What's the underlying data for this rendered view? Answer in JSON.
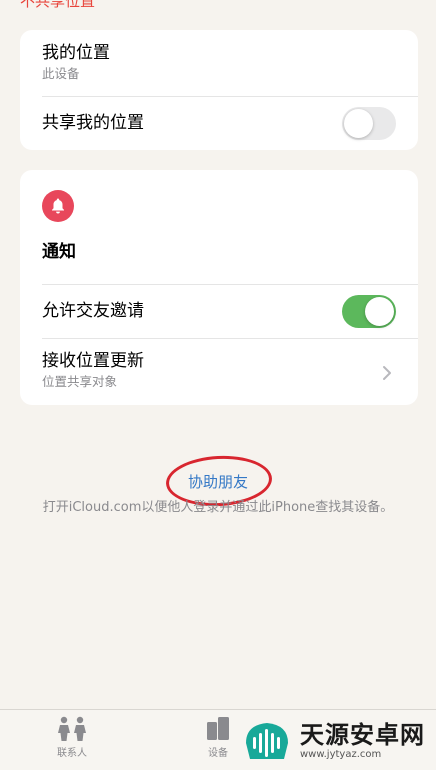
{
  "top_link": "不共享位置",
  "location_card": {
    "my_location_title": "我的位置",
    "my_location_sub": "此设备",
    "share_title": "共享我的位置",
    "share_toggle_on": false
  },
  "notify_card": {
    "icon": "bell-icon",
    "title": "通知",
    "allow_invite_title": "允许交友邀请",
    "allow_invite_toggle_on": true,
    "receive_updates_title": "接收位置更新",
    "receive_updates_sub": "位置共享对象"
  },
  "help": {
    "link": "协助朋友",
    "description": "打开iCloud.com以便他人登录并通过此iPhone查找其设备。"
  },
  "tabbar": {
    "tabs": [
      {
        "label": "联系人",
        "icon": "people-icon"
      },
      {
        "label": "设备",
        "icon": "devices-icon"
      }
    ]
  },
  "watermark": {
    "main": "天源安卓网",
    "url": "www.jytyaz.com"
  },
  "colors": {
    "accent_red": "#e8453c",
    "toggle_green": "#5cb85c",
    "link_blue": "#3478c6",
    "bell_bg": "#e8475b"
  }
}
